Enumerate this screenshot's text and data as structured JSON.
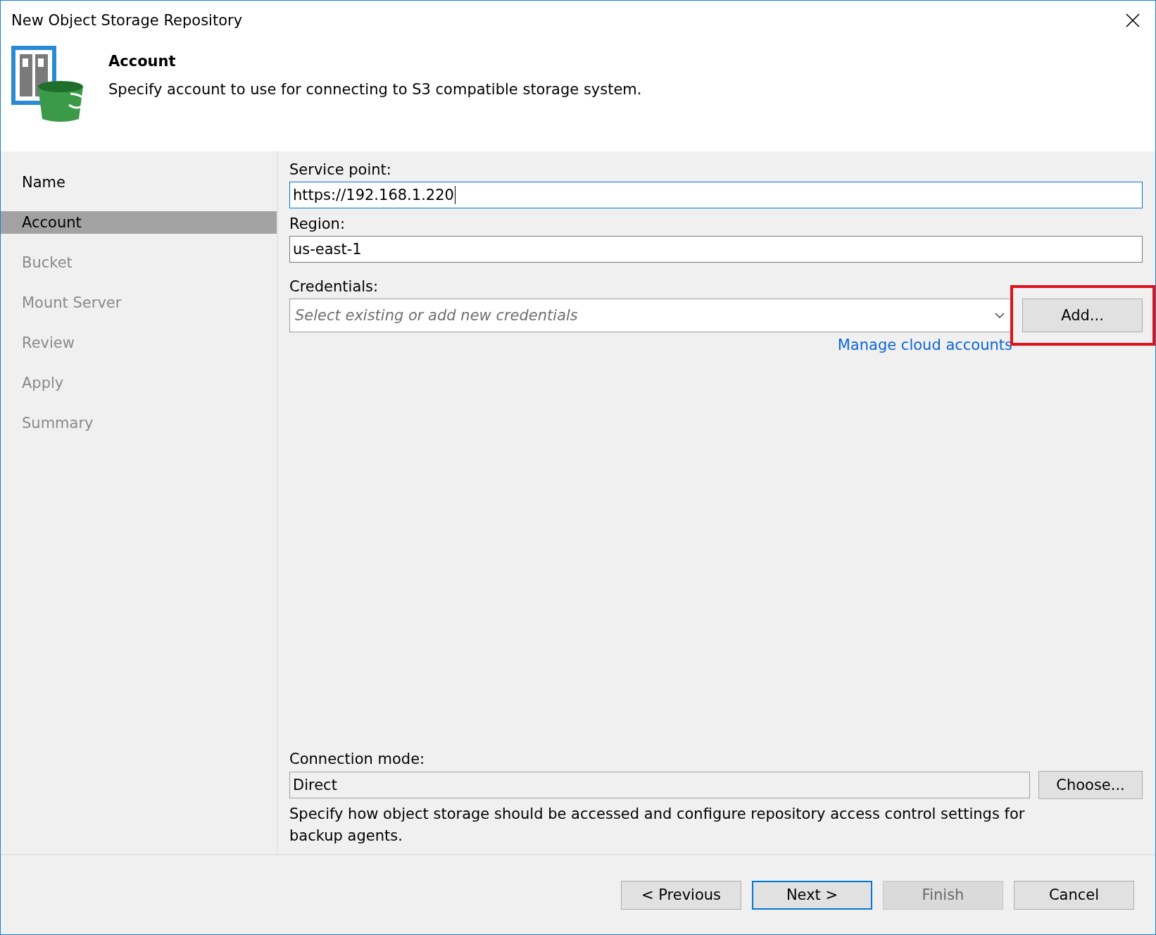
{
  "window": {
    "title": "New Object Storage Repository"
  },
  "header": {
    "title": "Account",
    "subtitle": "Specify account to use for connecting to S3 compatible storage system."
  },
  "steps": [
    {
      "label": "Name",
      "selected": false,
      "disabled": false
    },
    {
      "label": "Account",
      "selected": true,
      "disabled": false
    },
    {
      "label": "Bucket",
      "selected": false,
      "disabled": true
    },
    {
      "label": "Mount Server",
      "selected": false,
      "disabled": true
    },
    {
      "label": "Review",
      "selected": false,
      "disabled": true
    },
    {
      "label": "Apply",
      "selected": false,
      "disabled": true
    },
    {
      "label": "Summary",
      "selected": false,
      "disabled": true
    }
  ],
  "service_point": {
    "label": "Service point:",
    "value": "https://192.168.1.220",
    "focused": true
  },
  "region": {
    "label": "Region:",
    "value": "us-east-1",
    "focused": false
  },
  "credentials": {
    "label": "Credentials:",
    "placeholder": "Select existing or add new credentials",
    "add_button": "Add...",
    "highlighted": true,
    "link": "Manage cloud accounts"
  },
  "connection_mode": {
    "label": "Connection mode:",
    "value": "Direct",
    "button": "Choose...",
    "description": "Specify how object storage should be accessed and configure repository access control settings for backup agents."
  },
  "buttons": [
    {
      "label": "< Previous",
      "default": false,
      "disabled": false
    },
    {
      "label": "Next >",
      "default": true,
      "disabled": false
    },
    {
      "label": "Finish",
      "default": false,
      "disabled": true
    },
    {
      "label": "Cancel",
      "default": false,
      "disabled": false
    }
  ]
}
